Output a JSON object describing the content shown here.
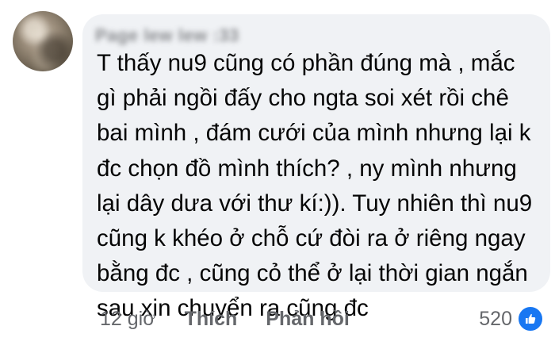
{
  "comment": {
    "author": "Page lew lew :33",
    "text": "T thấy nu9 cũng có phần đúng mà , mắc\ngì phải ngồi đấy cho ngta soi xét rồi chê\nbai mình , đám cưới của mình nhưng lại k\nđc chọn đồ mình thích? , ny mình nhưng\nlại dây dưa với thư kí:)). Tuy nhiên thì nu9\ncũng k khéo ở chỗ cứ đòi ra ở riêng ngay\nbằng đc , cũng cỏ thể ở lại thời gian ngắn\nsau xin chuyển ra cũng đc",
    "timestamp": "12 giờ",
    "like_label": "Thích",
    "reply_label": "Phản hồi",
    "reaction_count": "520",
    "reaction_icon": "like-icon",
    "reaction_color": "#1877f2"
  }
}
